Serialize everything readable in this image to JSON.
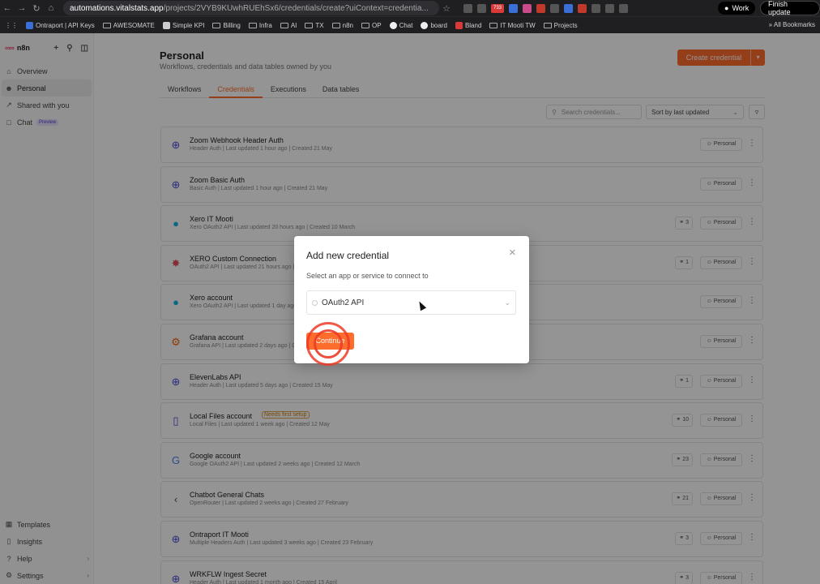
{
  "browser": {
    "url_host": "automations.vitalstats.app",
    "url_path": "/projects/2VYB9KUwhRUEhSx6/credentials/create?uiContext=credentia...",
    "badge_count": "733",
    "profile_label": "Work",
    "update_label": "Finish update",
    "bookmarks": [
      "Ontraport | API Keys",
      "AWESOMATE",
      "Simple KPI",
      "Billing",
      "Infra",
      "AI",
      "TX",
      "n8n",
      "OP",
      "Chat",
      "board",
      "Bland",
      "IT Mooti TW",
      "Projects"
    ],
    "all_bookmarks_label": "All Bookmarks"
  },
  "sidebar": {
    "logo_text": "n8n",
    "nav": [
      {
        "label": "Overview",
        "icon": "home-icon"
      },
      {
        "label": "Personal",
        "icon": "user-icon"
      },
      {
        "label": "Shared with you",
        "icon": "share-icon"
      },
      {
        "label": "Chat",
        "icon": "chat-icon",
        "badge": "Preview"
      }
    ],
    "bottom": [
      {
        "label": "Templates",
        "icon": "templates-icon"
      },
      {
        "label": "Insights",
        "icon": "insights-icon"
      },
      {
        "label": "Help",
        "icon": "help-icon"
      },
      {
        "label": "Settings",
        "icon": "settings-icon"
      }
    ]
  },
  "header": {
    "title": "Personal",
    "subtitle": "Workflows, credentials and data tables owned by you",
    "create_label": "Create credential",
    "tabs": [
      "Workflows",
      "Credentials",
      "Executions",
      "Data tables"
    ],
    "active_tab": "Credentials",
    "search_placeholder": "Search credentials...",
    "sort_label": "Sort by last updated"
  },
  "credentials": [
    {
      "name": "Zoom Webhook Header Auth",
      "meta": "Header Auth | Last updated 1 hour ago | Created 21 May",
      "links": "",
      "owner": "Personal",
      "icon": "globe-icon",
      "icon_color": "#4a4ad8"
    },
    {
      "name": "Zoom Basic Auth",
      "meta": "Basic Auth | Last updated 1 hour ago | Created 21 May",
      "links": "",
      "owner": "Personal",
      "icon": "globe-icon",
      "icon_color": "#4a4ad8"
    },
    {
      "name": "Xero IT Mooti",
      "meta": "Xero OAuth2 API | Last updated 20 hours ago | Created 10 March",
      "links": "3",
      "owner": "Personal",
      "icon": "xero-icon",
      "icon_color": "#13b5ea"
    },
    {
      "name": "XERO Custom Connection",
      "meta": "OAuth2 API | Last updated 21 hours ago | Created 1 March",
      "links": "1",
      "owner": "Personal",
      "icon": "oauth-icon",
      "icon_color": "#e0505c"
    },
    {
      "name": "Xero account",
      "meta": "Xero OAuth2 API | Last updated 1 day ago | Created 3 March",
      "links": "",
      "owner": "Personal",
      "icon": "xero-icon",
      "icon_color": "#13b5ea"
    },
    {
      "name": "Grafana account",
      "meta": "Grafana API | Last updated 2 days ago | Created 20 May",
      "links": "",
      "owner": "Personal",
      "icon": "grafana-icon",
      "icon_color": "#f46800"
    },
    {
      "name": "ElevenLabs API",
      "meta": "Header Auth | Last updated 5 days ago | Created 15 May",
      "links": "1",
      "owner": "Personal",
      "icon": "globe-icon",
      "icon_color": "#4a4ad8"
    },
    {
      "name": "Local Files account",
      "meta": "Local Files | Last updated 1 week ago | Created 12 May",
      "links": "10",
      "owner": "Personal",
      "icon": "file-icon",
      "icon_color": "#4a4ad8",
      "badge": "Needs first setup"
    },
    {
      "name": "Google account",
      "meta": "Google OAuth2 API | Last updated 2 weeks ago | Created 12 March",
      "links": "23",
      "owner": "Personal",
      "icon": "google-icon",
      "icon_color": "#4285f4"
    },
    {
      "name": "Chatbot General Chats",
      "meta": "OpenRouter | Last updated 2 weeks ago | Created 27 February",
      "links": "21",
      "owner": "Personal",
      "icon": "openrouter-icon",
      "icon_color": "#555555"
    },
    {
      "name": "Ontraport IT Mooti",
      "meta": "Multiple Headers Auth | Last updated 3 weeks ago | Created 23 February",
      "links": "3",
      "owner": "Personal",
      "icon": "globe-icon",
      "icon_color": "#4a4ad8"
    },
    {
      "name": "WRKFLW Ingest Secret",
      "meta": "Header Auth | Last updated 1 month ago | Created 15 April",
      "links": "3",
      "owner": "Personal",
      "icon": "globe-icon",
      "icon_color": "#4a4ad8"
    }
  ],
  "modal": {
    "title": "Add new credential",
    "description": "Select an app or service to connect to",
    "selected": "OAuth2 API",
    "continue_label": "Continue",
    "close_icon": "close-icon"
  },
  "colors": {
    "accent": "#ff6d2d"
  }
}
